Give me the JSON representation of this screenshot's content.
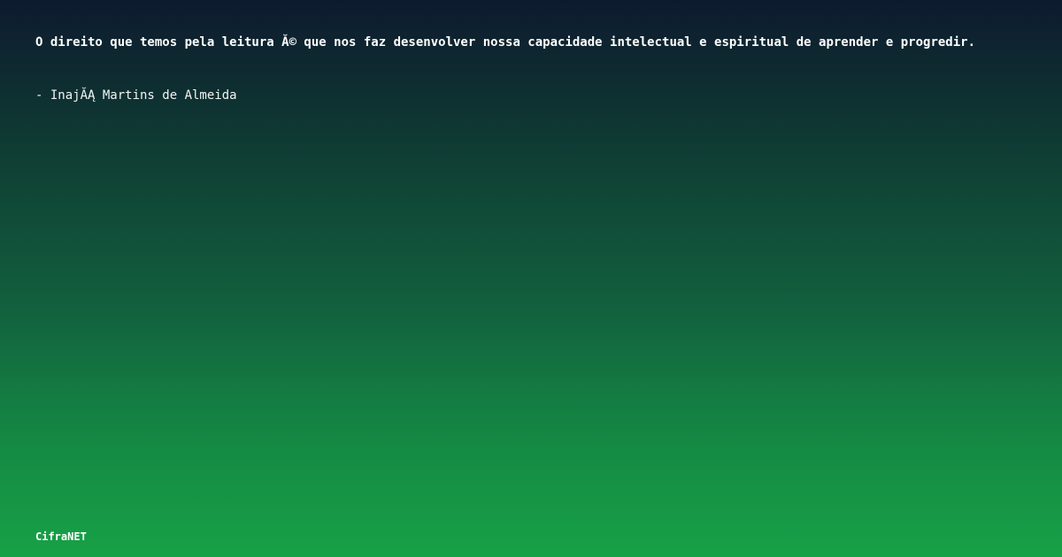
{
  "quote": {
    "text": "O direito que temos pela leitura Ă© que nos faz desenvolver nossa capacidade intelectual e espiritual de aprender e progredir.",
    "author": "- InajĂĄ Martins de Almeida"
  },
  "brand": {
    "name": "CifraNET"
  },
  "colors": {
    "gradient_top": "#0d1a2e",
    "gradient_bottom": "#17a147",
    "text": "#ffffff"
  }
}
